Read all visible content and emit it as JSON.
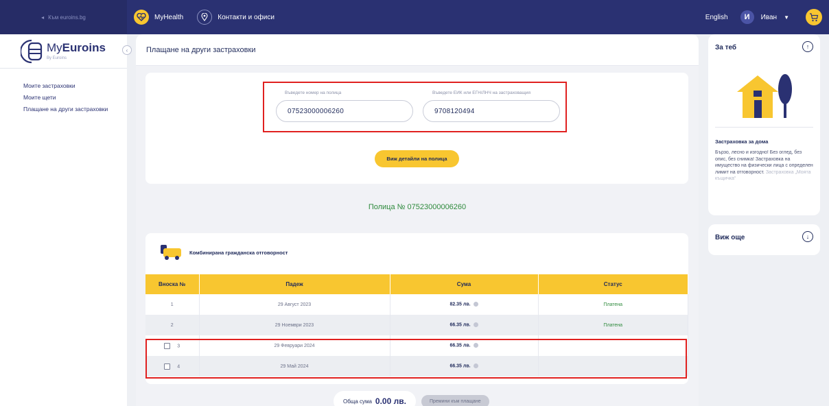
{
  "topbar": {
    "back_link": "Към euroins.bg",
    "nav_items": [
      {
        "label": "MyHealth",
        "icon": "heart-pulse-icon"
      },
      {
        "label": "Контакти и офиси",
        "icon": "location-pin-icon"
      }
    ],
    "language": "English",
    "avatar_initial": "И",
    "user_name": "Иван"
  },
  "sidebar": {
    "logo_main": "My",
    "logo_bold": "Euroins",
    "logo_sub": "By Euroins",
    "items": [
      {
        "label": "Моите застраховки"
      },
      {
        "label": "Моите щети"
      },
      {
        "label": "Плащане на други застраховки"
      }
    ]
  },
  "main": {
    "title": "Плащане на други застраховки",
    "policy_field": {
      "label": "Въведете номер на полица",
      "value": "07523000006260"
    },
    "id_field": {
      "label": "Въведете ЕИК или ЕГН/ЛНЧ на застраховащия",
      "value": "9708120494"
    },
    "details_button": "Виж детайли на полица",
    "policy_title": "Полица № 07523000006260",
    "product_name": "Комбинирана гражданска отговорност",
    "table": {
      "headers": [
        "Вноска №",
        "Падеж",
        "Сума",
        "Статус"
      ],
      "rows": [
        {
          "num": "1",
          "due": "29 Август 2023",
          "amount": "82.35 лв.",
          "status": "Платена",
          "checkbox": false
        },
        {
          "num": "2",
          "due": "29 Ноември 2023",
          "amount": "66.35 лв.",
          "status": "Платена",
          "checkbox": false
        },
        {
          "num": "3",
          "due": "29 Февруари 2024",
          "amount": "66.35 лв.",
          "status": "",
          "checkbox": true
        },
        {
          "num": "4",
          "due": "29 Май 2024",
          "amount": "66.35 лв.",
          "status": "",
          "checkbox": true
        }
      ]
    },
    "total_label": "Обща сума",
    "total_value": "0.00 лв.",
    "pay_button": "Премини към плащане"
  },
  "right": {
    "for_you_title": "За теб",
    "promo_title": "Застраховка за дома",
    "promo_text": "Бързо, лесно и изгодно! Без оглед, без опис, без снимка! Застраховка на имущество на физически лица с определен лимит на отговорност.",
    "promo_fade": "Застраховка „Моята къщичка“",
    "see_more": "Виж още"
  },
  "colors": {
    "navy": "#2a3172",
    "yellow": "#f8c630",
    "green": "#2e8a3c",
    "highlight": "#e0201f"
  }
}
